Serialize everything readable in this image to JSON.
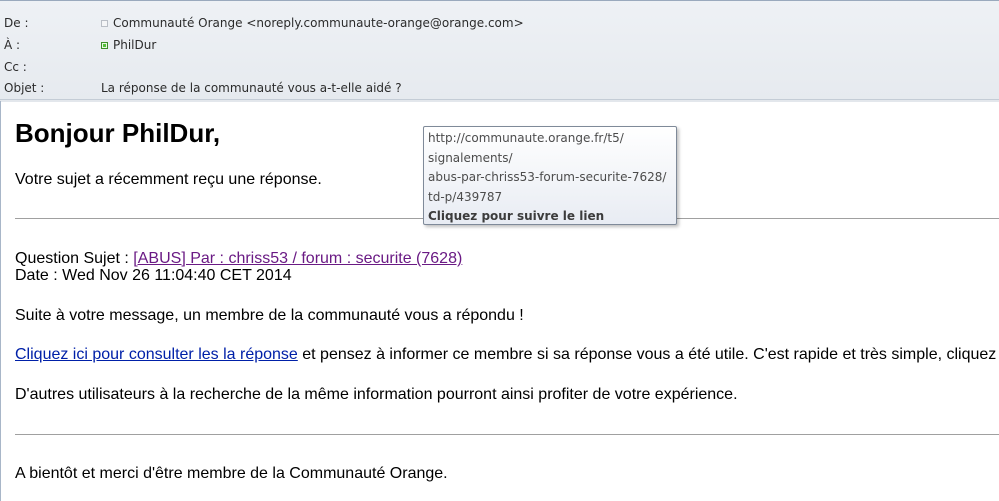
{
  "header": {
    "from_label": "De :",
    "from_value": "Communauté Orange <noreply.communaute-orange@orange.com>",
    "to_label": "À :",
    "to_value": "PhilDur",
    "cc_label": "Cc :",
    "cc_value": "",
    "subject_label": "Objet :",
    "subject_value": "La réponse de la communauté vous a-t-elle aidé ?"
  },
  "message": {
    "greeting": "Bonjour PhilDur,",
    "intro": "Votre sujet a récemment reçu une réponse.",
    "question_label": "Question Sujet : ",
    "question_link": "[ABUS] Par : chriss53 / forum : securite (7628)",
    "date_line": "Date : Wed Nov 26 11:04:40 CET 2014",
    "reply_note": "Suite à votre message, un membre de la communauté vous a répondu !",
    "consult_link": "Cliquez ici pour consulter les la réponse",
    "consult_rest": " et pensez à informer ce membre si sa réponse vous a été utile. C'est rapide et très simple, cliquez s",
    "others": "D'autres utilisateurs à la recherche de la même information pourront ainsi profiter de votre expérience.",
    "closing": "A bientôt et merci d'être membre de la Communauté Orange."
  },
  "tooltip": {
    "url_lines": [
      "http://communaute.orange.fr/t5/",
      "signalements/",
      "abus-par-chriss53-forum-securite-7628/",
      "td-p/439787"
    ],
    "hint": "Cliquez pour suivre le lien"
  },
  "colors": {
    "visited_link": "#6a1a84",
    "link": "#0020a8",
    "presence_online": "#53c13a"
  }
}
